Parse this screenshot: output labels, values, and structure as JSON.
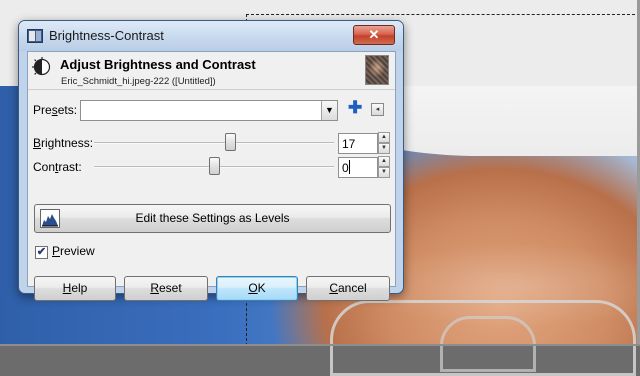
{
  "dialog": {
    "title": "Brightness-Contrast",
    "close_label": "✕",
    "heading": "Adjust Brightness and Contrast",
    "subheading": "Eric_Schmidt_hi.jpeg-222 ([Untitled])"
  },
  "presets": {
    "label_prefix": "Pre",
    "label_accel": "s",
    "label_suffix": "ets:",
    "value": "",
    "dropdown_glyph": "▼",
    "add_glyph": "✚",
    "menu_glyph": "◂"
  },
  "brightness": {
    "label_accel": "B",
    "label_rest": "rightness:",
    "value": "17",
    "range": [
      -127,
      127
    ]
  },
  "contrast": {
    "label_prefix": "Con",
    "label_accel": "t",
    "label_rest": "rast:",
    "value": "0",
    "range": [
      -127,
      127
    ]
  },
  "spin_glyphs": {
    "up": "▲",
    "down": "▼"
  },
  "levels_button": {
    "label": "Edit these Settings as Levels"
  },
  "preview": {
    "label_accel": "P",
    "label_rest": "review",
    "checked": true,
    "check_glyph": "✔"
  },
  "buttons": {
    "help": {
      "accel": "H",
      "rest": "elp"
    },
    "reset": {
      "accel": "R",
      "rest": "eset"
    },
    "ok": {
      "accel": "O",
      "rest": "K"
    },
    "cancel": {
      "accel": "C",
      "rest": "ancel"
    }
  },
  "colors": {
    "ok_accent": "#3c7fb1",
    "close_button": "#c3422b",
    "add_icon": "#1f5fc2"
  }
}
